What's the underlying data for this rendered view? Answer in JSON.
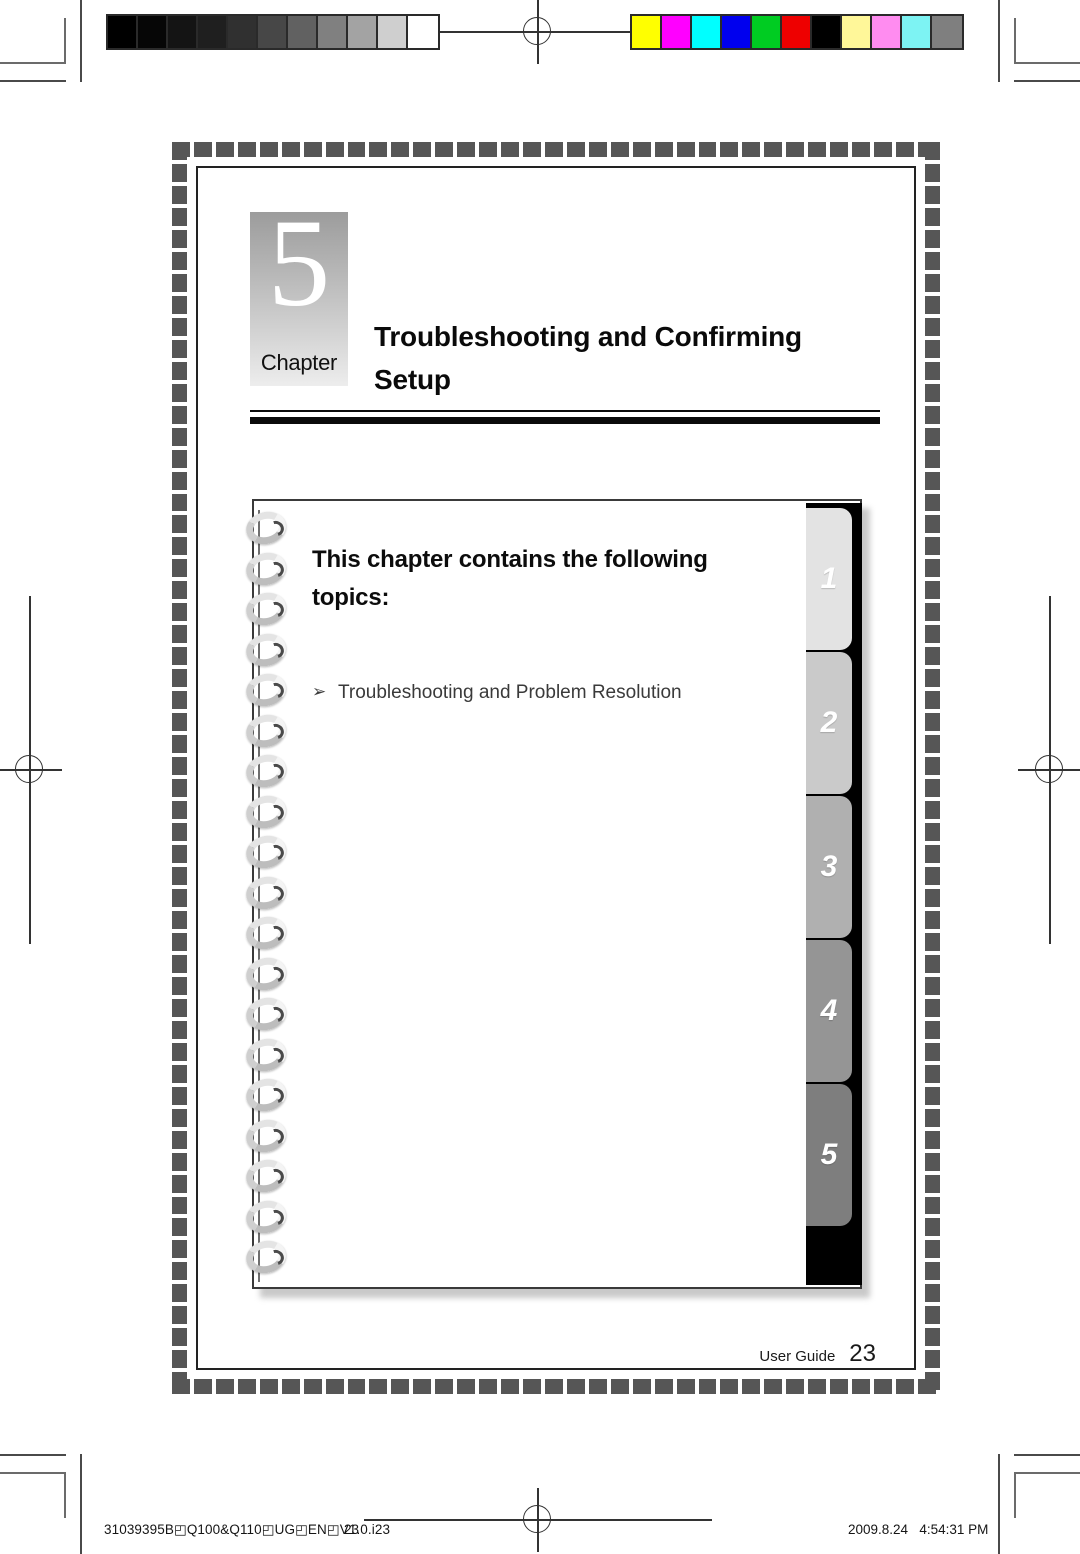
{
  "document": {
    "chapter_number": "5",
    "chapter_label": "Chapter",
    "chapter_title": "Troubleshooting and Confirming Setup"
  },
  "card": {
    "heading": "This chapter contains the following topics:",
    "bullet_glyph": "➢",
    "topics": [
      {
        "label": "Troubleshooting and Problem Resolution"
      }
    ]
  },
  "tabs": [
    {
      "number": "1",
      "color": "#e3e3e3"
    },
    {
      "number": "2",
      "color": "#cacaca"
    },
    {
      "number": "3",
      "color": "#b0b0b0"
    },
    {
      "number": "4",
      "color": "#959595"
    },
    {
      "number": "5",
      "color": "#7e7e7e"
    }
  ],
  "page_footer": {
    "guide_label": "User Guide",
    "page_number": "23"
  },
  "print_footer": {
    "job_id": "31039395B◰Q100&Q110◰UG◰EN◰V1.0.i23",
    "job_page": "23",
    "date": "2009.8.24",
    "time": "4:54:31 PM"
  },
  "calibration": {
    "grayscale_label": "grayscale-step-wedge",
    "grayscale_swatches": [
      "#000000",
      "#060606",
      "#141414",
      "#1f1f1f",
      "#303030",
      "#474747",
      "#616161",
      "#808080",
      "#a3a3a3",
      "#cfcfcf",
      "#ffffff"
    ],
    "color_label": "process-color-bar",
    "color_swatches": [
      "#ffff00",
      "#ff00ff",
      "#00ffff",
      "#0000ee",
      "#00cc22",
      "#ee0000",
      "#000000",
      "#fff799",
      "#ff8cf0",
      "#7df3f3",
      "#7f7f7f"
    ]
  },
  "marks": {
    "registration_label": "registration-target",
    "crop_label": "crop-mark"
  }
}
